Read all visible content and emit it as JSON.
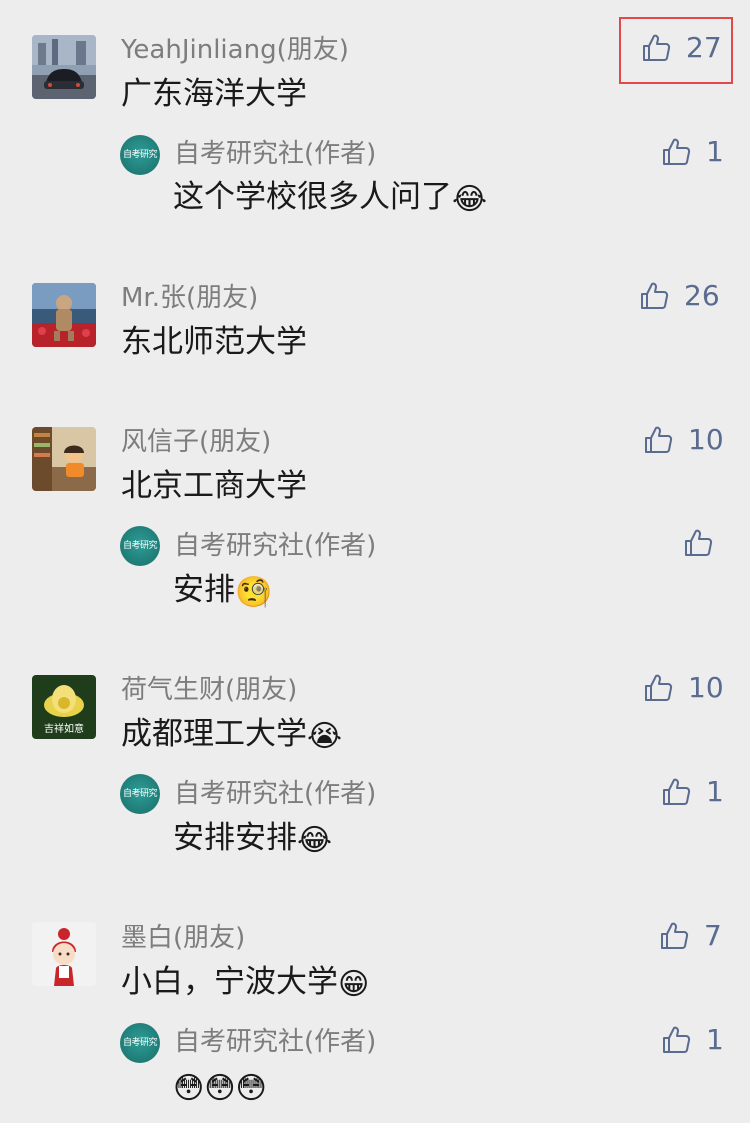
{
  "comments": [
    {
      "user": "YeahJinliang(朋友)",
      "text": "广东海洋大学",
      "likes": "27",
      "avatar": "car-photo",
      "reply": {
        "user": "自考研究社(作者)",
        "avatar_text": "自考研究社",
        "text": "这个学校很多人问了",
        "emoji": "😂",
        "likes": "1"
      }
    },
    {
      "user": "Mr.张(朋友)",
      "text": "东北师范大学",
      "likes": "26",
      "avatar": "astronaut-in-flowers"
    },
    {
      "user": "风信子(朋友)",
      "text": "北京工商大学",
      "likes": "10",
      "avatar": "illustrated-room",
      "reply": {
        "user": "自考研究社(作者)",
        "avatar_text": "自考研究社",
        "text": "安排",
        "emoji": "🧐",
        "likes": ""
      }
    },
    {
      "user": "荷气生财(朋友)",
      "text": "成都理工大学",
      "emoji": "😭",
      "likes": "10",
      "avatar": "lotus-flower",
      "avatar_text": "吉祥如意",
      "reply": {
        "user": "自考研究社(作者)",
        "avatar_text": "自考研究社",
        "text": "安排安排",
        "emoji": "😂",
        "likes": "1"
      }
    },
    {
      "user": "墨白(朋友)",
      "text": "小白，宁波大学",
      "emoji": "😁",
      "likes": "7",
      "avatar": "cartoon-girl",
      "reply": {
        "user": "自考研究社(作者)",
        "avatar_text": "自考研究社",
        "text": "",
        "emoji": "😳😳😳",
        "likes": "1"
      }
    }
  ],
  "colors": {
    "background": "#ededed",
    "name": "#7d7d7d",
    "text": "#1a1a1a",
    "like": "#5a6b90",
    "highlight": "#e04a4a"
  },
  "icons": [
    "thumbs-up-icon"
  ]
}
